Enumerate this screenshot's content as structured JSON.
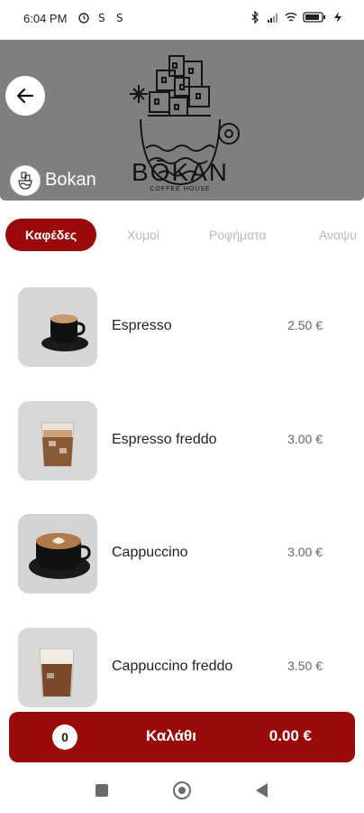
{
  "status_bar": {
    "time": "6:04 PM",
    "icons_left": [
      "alarm-icon",
      "s-icon",
      "s-icon"
    ],
    "icons_right": [
      "bluetooth-icon",
      "signal-icon",
      "wifi-icon",
      "battery-icon",
      "charging-icon"
    ],
    "battery": "85"
  },
  "header": {
    "logo_title": "BŌKAN",
    "logo_subtitle": "COFFEE HOUSE",
    "brand_name": "Bokan",
    "banner_color": "#7f7f7f"
  },
  "tabs": [
    {
      "label": "Καφέδες",
      "active": true
    },
    {
      "label": "Χυμοί",
      "active": false
    },
    {
      "label": "Ροφήματα",
      "active": false
    },
    {
      "label": "Αναψυ",
      "active": false
    }
  ],
  "items": [
    {
      "name": "Espresso",
      "price": "2.50 €",
      "image": "espresso-cup"
    },
    {
      "name": "Espresso freddo",
      "price": "3.00 €",
      "image": "iced-glass"
    },
    {
      "name": "Cappuccino",
      "price": "3.00 €",
      "image": "cappuccino-cup"
    },
    {
      "name": "Cappuccino freddo",
      "price": "3.50 €",
      "image": "iced-foam-glass"
    }
  ],
  "cart": {
    "count": "0",
    "label": "Καλάθι",
    "total": "0.00 €"
  },
  "colors": {
    "accent": "#9b0a0a"
  }
}
